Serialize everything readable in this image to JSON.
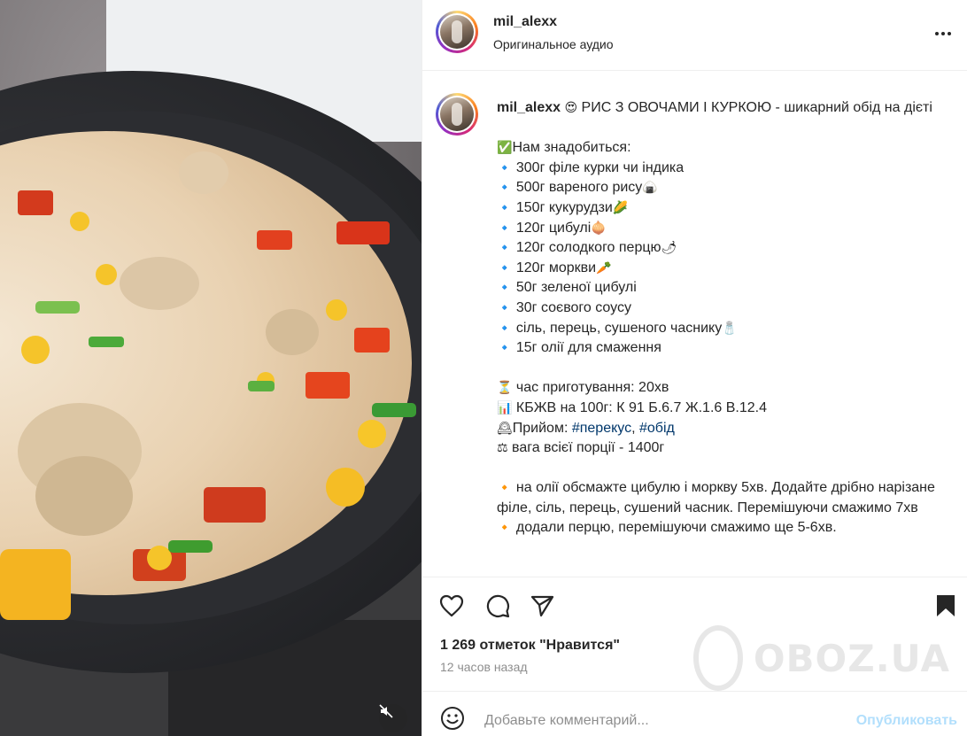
{
  "post": {
    "username": "mil_alexx",
    "audio": "Оригинальное аудио",
    "caption": {
      "username": "mil_alexx",
      "lines": [
        {
          "icon": "😍",
          "text": " РИС З ОВОЧАМИ І КУРКОЮ - шикарний обід на дієті"
        },
        {
          "text": ""
        },
        {
          "icon": "✅",
          "text": "Нам знадобиться:"
        },
        {
          "icon": "🔹",
          "text": " 300г філе курки чи індика"
        },
        {
          "icon": "🔹",
          "text": " 500г вареного рису",
          "tail": "🍙"
        },
        {
          "icon": "🔹",
          "text": " 150г кукурудзи",
          "tail": "🌽"
        },
        {
          "icon": "🔹",
          "text": " 120г цибулі",
          "tail": "🧅"
        },
        {
          "icon": "🔹",
          "text": " 120г солодкого перцю",
          "tail": "🌶"
        },
        {
          "icon": "🔹",
          "text": " 120г моркви",
          "tail": "🥕"
        },
        {
          "icon": "🔹",
          "text": " 50г зеленої цибулі"
        },
        {
          "icon": "🔹",
          "text": " 30г соєвого соусу"
        },
        {
          "icon": "🔹",
          "text": " сіль, перець, сушеного часнику",
          "tail": "🧂"
        },
        {
          "icon": "🔹",
          "text": " 15г олії для смаження"
        },
        {
          "text": ""
        },
        {
          "icon": "⏳",
          "text": " час приготування: 20хв"
        },
        {
          "icon": "📊",
          "text": " КБЖВ на 100г: К 91 Б.6.7 Ж.1.6 В.12.4"
        },
        {
          "icon": "🕰",
          "text": "Прийом: ",
          "tags": [
            "#перекус",
            "#обід"
          ]
        },
        {
          "icon": "⚖",
          "text": " вага всієї порції - 1400г"
        },
        {
          "text": ""
        },
        {
          "icon": "🔸",
          "text": " на олії обсмажте цибулю і моркву 5хв. Додайте дрібно нарізане філе, сіль, перець, сушений часник. Перемішуючи смажимо 7хв"
        },
        {
          "icon": "🔸",
          "text": " додали перцю, перемішуючи смажимо ще 5-6хв."
        }
      ]
    },
    "likes": "1 269 отметок \"Нравится\"",
    "time": "12 часов назад",
    "comment_placeholder": "Добавьте комментарий...",
    "publish_label": "Опубликовать"
  },
  "watermark": {
    "brand": "OBOZ.UA"
  },
  "icons": {
    "more": "more-horizontal-icon",
    "like": "heart-icon",
    "comment": "comment-icon",
    "share": "send-icon",
    "save": "bookmark-icon",
    "emoji": "smiley-icon",
    "mute": "speaker-muted-icon"
  },
  "colors": {
    "hashtag": "#00376b",
    "publish": "#b2dffc",
    "muted_text": "#8e8e8e"
  }
}
